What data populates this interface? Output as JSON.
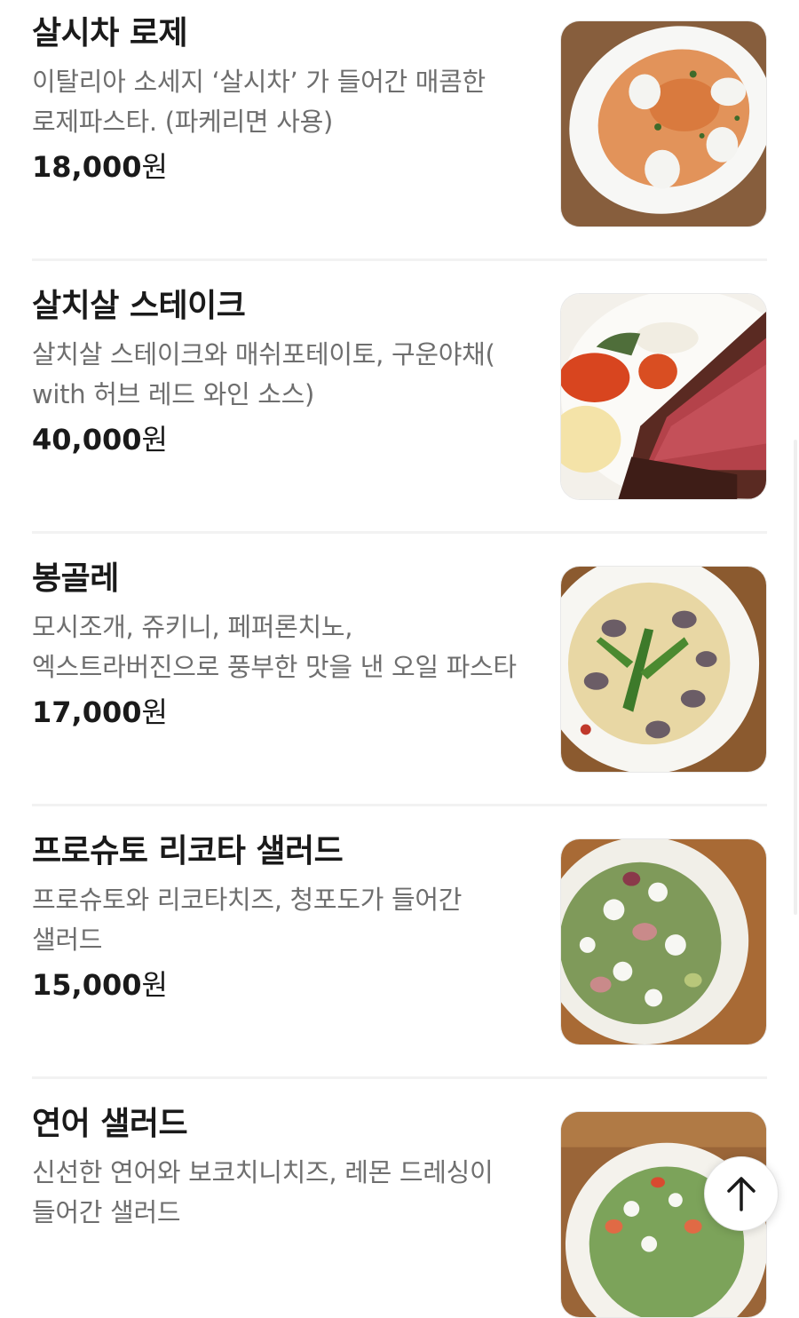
{
  "menu": {
    "items": [
      {
        "name": "살시차 로제",
        "description": "이탈리아 소세지 ‘살시차’ 가 들어간 매콤한 로제파스타. (파케리면 사용)",
        "price": "18,000",
        "currency": "원",
        "photo": "rose-pasta-photo"
      },
      {
        "name": "살치살 스테이크",
        "description": "살치살 스테이크와 매쉬포테이토, 구운야채( with 허브 레드 와인 소스)",
        "price": "40,000",
        "currency": "원",
        "photo": "steak-photo"
      },
      {
        "name": "봉골레",
        "description": "모시조개, 쥬키니, 페퍼론치노, 엑스트라버진으로 풍부한 맛을 낸 오일 파스타",
        "price": "17,000",
        "currency": "원",
        "photo": "vongole-photo"
      },
      {
        "name": "프로슈토 리코타 샐러드",
        "description": "프로슈토와 리코타치즈, 청포도가 들어간 샐러드",
        "price": "15,000",
        "currency": "원",
        "photo": "prosciutto-salad-photo"
      },
      {
        "name": "연어 샐러드",
        "description": "신선한 연어와 보코치니치즈, 레몬 드레싱이 들어간 샐러드",
        "price": "",
        "currency": "",
        "photo": "salmon-salad-photo"
      }
    ]
  },
  "scroll_top": {
    "icon": "arrow-up-icon"
  },
  "colors": {
    "title": "#1a1a1a",
    "description": "#6e6e6e",
    "divider": "#f2f2f2",
    "wood": "#8a5a34"
  }
}
